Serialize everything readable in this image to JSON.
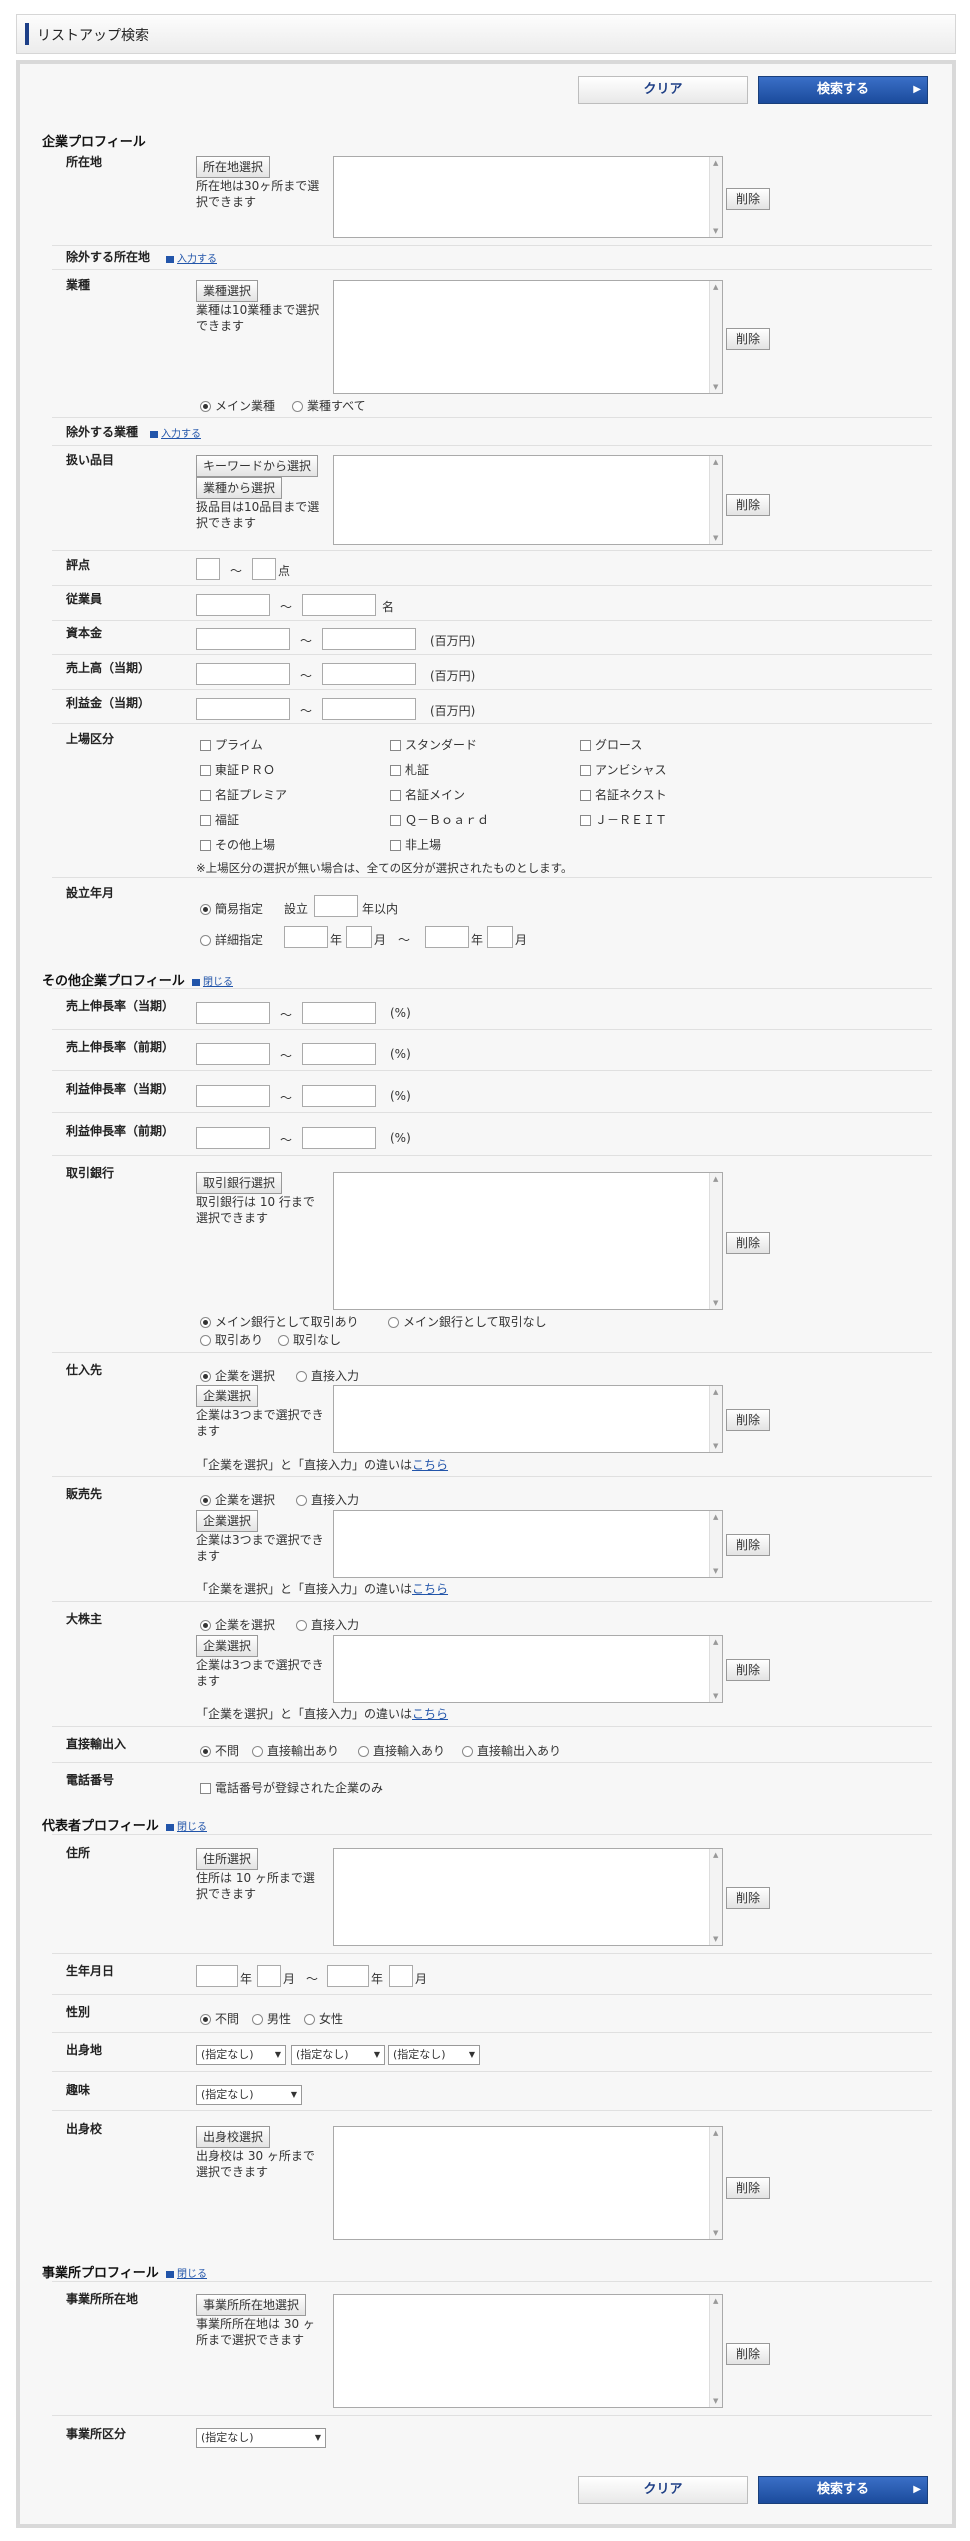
{
  "header": {
    "title": "リストアップ検索"
  },
  "buttons": {
    "clear": "クリア",
    "search": "検索する",
    "delete": "削除"
  },
  "sections": {
    "company": "企業プロフィール",
    "other": "その他企業プロフィール",
    "rep": "代表者プロフィール",
    "office": "事業所プロフィール"
  },
  "links": {
    "input": "入力する",
    "close": "閉じる"
  },
  "company": {
    "location": {
      "label": "所在地",
      "button": "所在地選択",
      "note": "所在地は30ヶ所まで選択できます"
    },
    "excl_location": {
      "label": "除外する所在地"
    },
    "industry": {
      "label": "業種",
      "button": "業種選択",
      "note": "業種は10業種まで選択できます",
      "radio_main": "メイン業種",
      "radio_all": "業種すべて"
    },
    "excl_industry": {
      "label": "除外する業種"
    },
    "products": {
      "label": "扱い品目",
      "button_kw": "キーワードから選択",
      "button_ind": "業種から選択",
      "note": "扱品目は10品目まで選択できます"
    },
    "score": {
      "label": "評点",
      "tilde": "～",
      "unit": "点"
    },
    "employees": {
      "label": "従業員",
      "unit": "名"
    },
    "capital": {
      "label": "資本金",
      "unit": "(百万円)"
    },
    "sales": {
      "label": "売上高（当期）",
      "unit": "(百万円)"
    },
    "profit": {
      "label": "利益金（当期）",
      "unit": "(百万円)"
    },
    "listing": {
      "label": "上場区分",
      "items": [
        "プライム",
        "スタンダード",
        "グロース",
        "東証ＰＲＯ",
        "札証",
        "アンビシャス",
        "名証プレミア",
        "名証メイン",
        "名証ネクスト",
        "福証",
        "Ｑ－Ｂｏａｒｄ",
        "Ｊ－ＲＥＩＴ",
        "その他上場",
        "非上場"
      ],
      "note": "※上場区分の選択が無い場合は、全ての区分が選択されたものとします。"
    },
    "founded": {
      "label": "設立年月",
      "simple": "簡易指定",
      "setsu": "設立",
      "within": "年以内",
      "detail": "詳細指定",
      "year": "年",
      "month": "月"
    }
  },
  "other": {
    "sales_growth_cur": {
      "label": "売上伸長率（当期）",
      "unit": "(%)"
    },
    "sales_growth_prev": {
      "label": "売上伸長率（前期）",
      "unit": "(%)"
    },
    "profit_growth_cur": {
      "label": "利益伸長率（当期）",
      "unit": "(%)"
    },
    "profit_growth_prev": {
      "label": "利益伸長率（前期）",
      "unit": "(%)"
    },
    "bank": {
      "label": "取引銀行",
      "button": "取引銀行選択",
      "note": "取引銀行は 10 行まで選択できます",
      "r1": "メイン銀行として取引あり",
      "r2": "メイン銀行として取引なし",
      "r3": "取引あり",
      "r4": "取引なし"
    },
    "supplier": {
      "label": "仕入先"
    },
    "customer": {
      "label": "販売先"
    },
    "shareholder": {
      "label": "大株主"
    },
    "partner": {
      "sel_company": "企業を選択",
      "direct": "直接入力",
      "button": "企業選択",
      "note": "企業は3つまで選択できます",
      "diff": "「企業を選択」と「直接入力」の違いは",
      "here": "こちら"
    },
    "trade": {
      "label": "直接輸出入",
      "opts": [
        "不問",
        "直接輸出あり",
        "直接輸入あり",
        "直接輸出入あり"
      ]
    },
    "phone": {
      "label": "電話番号",
      "opt": "電話番号が登録された企業のみ"
    }
  },
  "rep": {
    "address": {
      "label": "住所",
      "button": "住所選択",
      "note": "住所は 10 ヶ所まで選択できます"
    },
    "birth": {
      "label": "生年月日",
      "year": "年",
      "month": "月",
      "tilde": "～"
    },
    "gender": {
      "label": "性別",
      "opts": [
        "不問",
        "男性",
        "女性"
      ]
    },
    "hometown": {
      "label": "出身地",
      "sel": "(指定なし)"
    },
    "hobby": {
      "label": "趣味",
      "sel": "(指定なし)"
    },
    "school": {
      "label": "出身校",
      "button": "出身校選択",
      "note": "出身校は 30 ヶ所まで選択できます"
    }
  },
  "office": {
    "location": {
      "label": "事業所所在地",
      "button": "事業所所在地選択",
      "note": "事業所所在地は 30 ヶ所まで選択できます"
    },
    "type": {
      "label": "事業所区分",
      "sel": "(指定なし)"
    }
  }
}
